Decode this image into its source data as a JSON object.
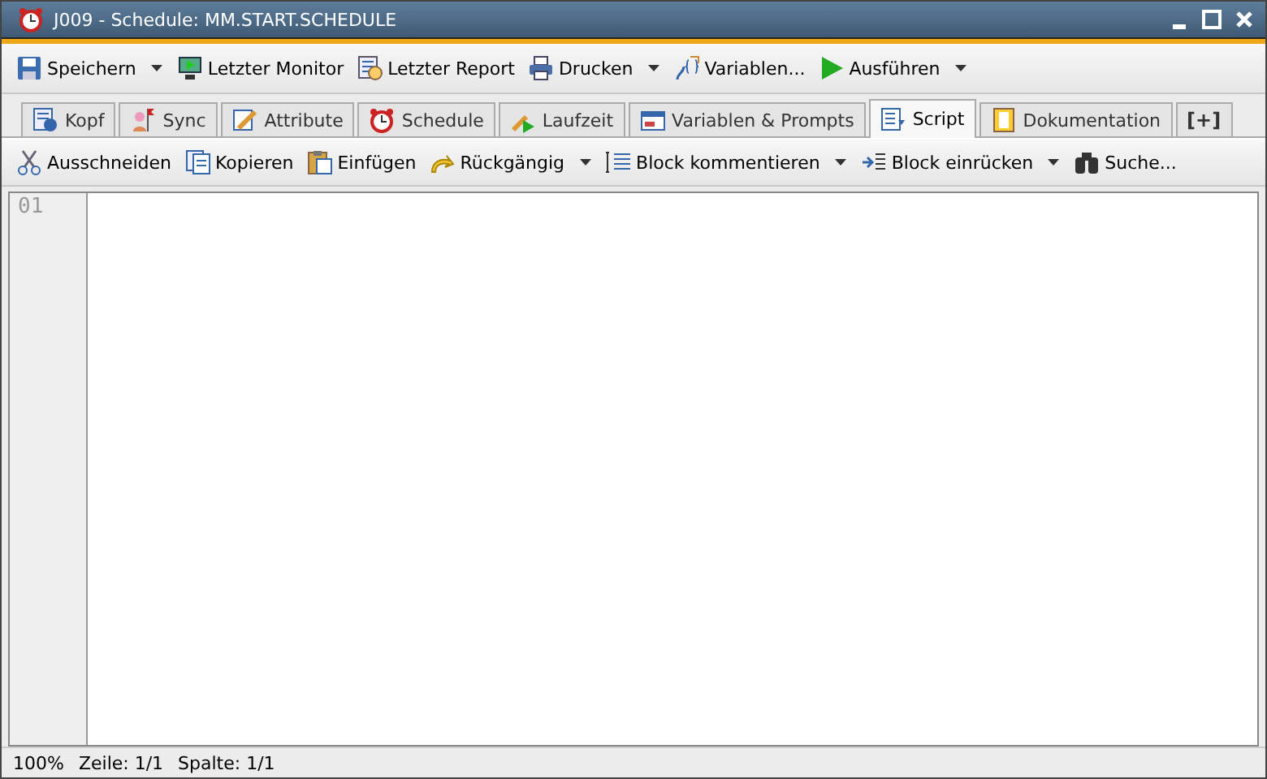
{
  "window": {
    "title": "J009 - Schedule: MM.START.SCHEDULE"
  },
  "toolbar": [
    {
      "label": "Speichern",
      "dropdown": true
    },
    {
      "label": "Letzter Monitor",
      "dropdown": false
    },
    {
      "label": "Letzter Report",
      "dropdown": false
    },
    {
      "label": "Drucken",
      "dropdown": true
    },
    {
      "label": "Variablen...",
      "dropdown": false
    },
    {
      "label": "Ausführen",
      "dropdown": true
    }
  ],
  "tabs": [
    {
      "label": "Kopf",
      "selected": false
    },
    {
      "label": "Sync",
      "selected": false
    },
    {
      "label": "Attribute",
      "selected": false
    },
    {
      "label": "Schedule",
      "selected": false
    },
    {
      "label": "Laufzeit",
      "selected": false
    },
    {
      "label": "Variablen & Prompts",
      "selected": false
    },
    {
      "label": "Script",
      "selected": true
    },
    {
      "label": "Dokumentation",
      "selected": false
    },
    {
      "label": "[+]",
      "selected": false
    }
  ],
  "editor_toolbar": [
    {
      "label": "Ausschneiden",
      "dropdown": false
    },
    {
      "label": "Kopieren",
      "dropdown": false
    },
    {
      "label": "Einfügen",
      "dropdown": false
    },
    {
      "label": "Rückgängig",
      "dropdown": true
    },
    {
      "label": "Block kommentieren",
      "dropdown": true
    },
    {
      "label": "Block einrücken",
      "dropdown": true
    },
    {
      "label": "Suche...",
      "dropdown": false
    }
  ],
  "editor": {
    "line_numbers": [
      "01"
    ]
  },
  "status_bar": [
    "100%",
    "Zeile: 1/1",
    "Spalte: 1/1"
  ]
}
